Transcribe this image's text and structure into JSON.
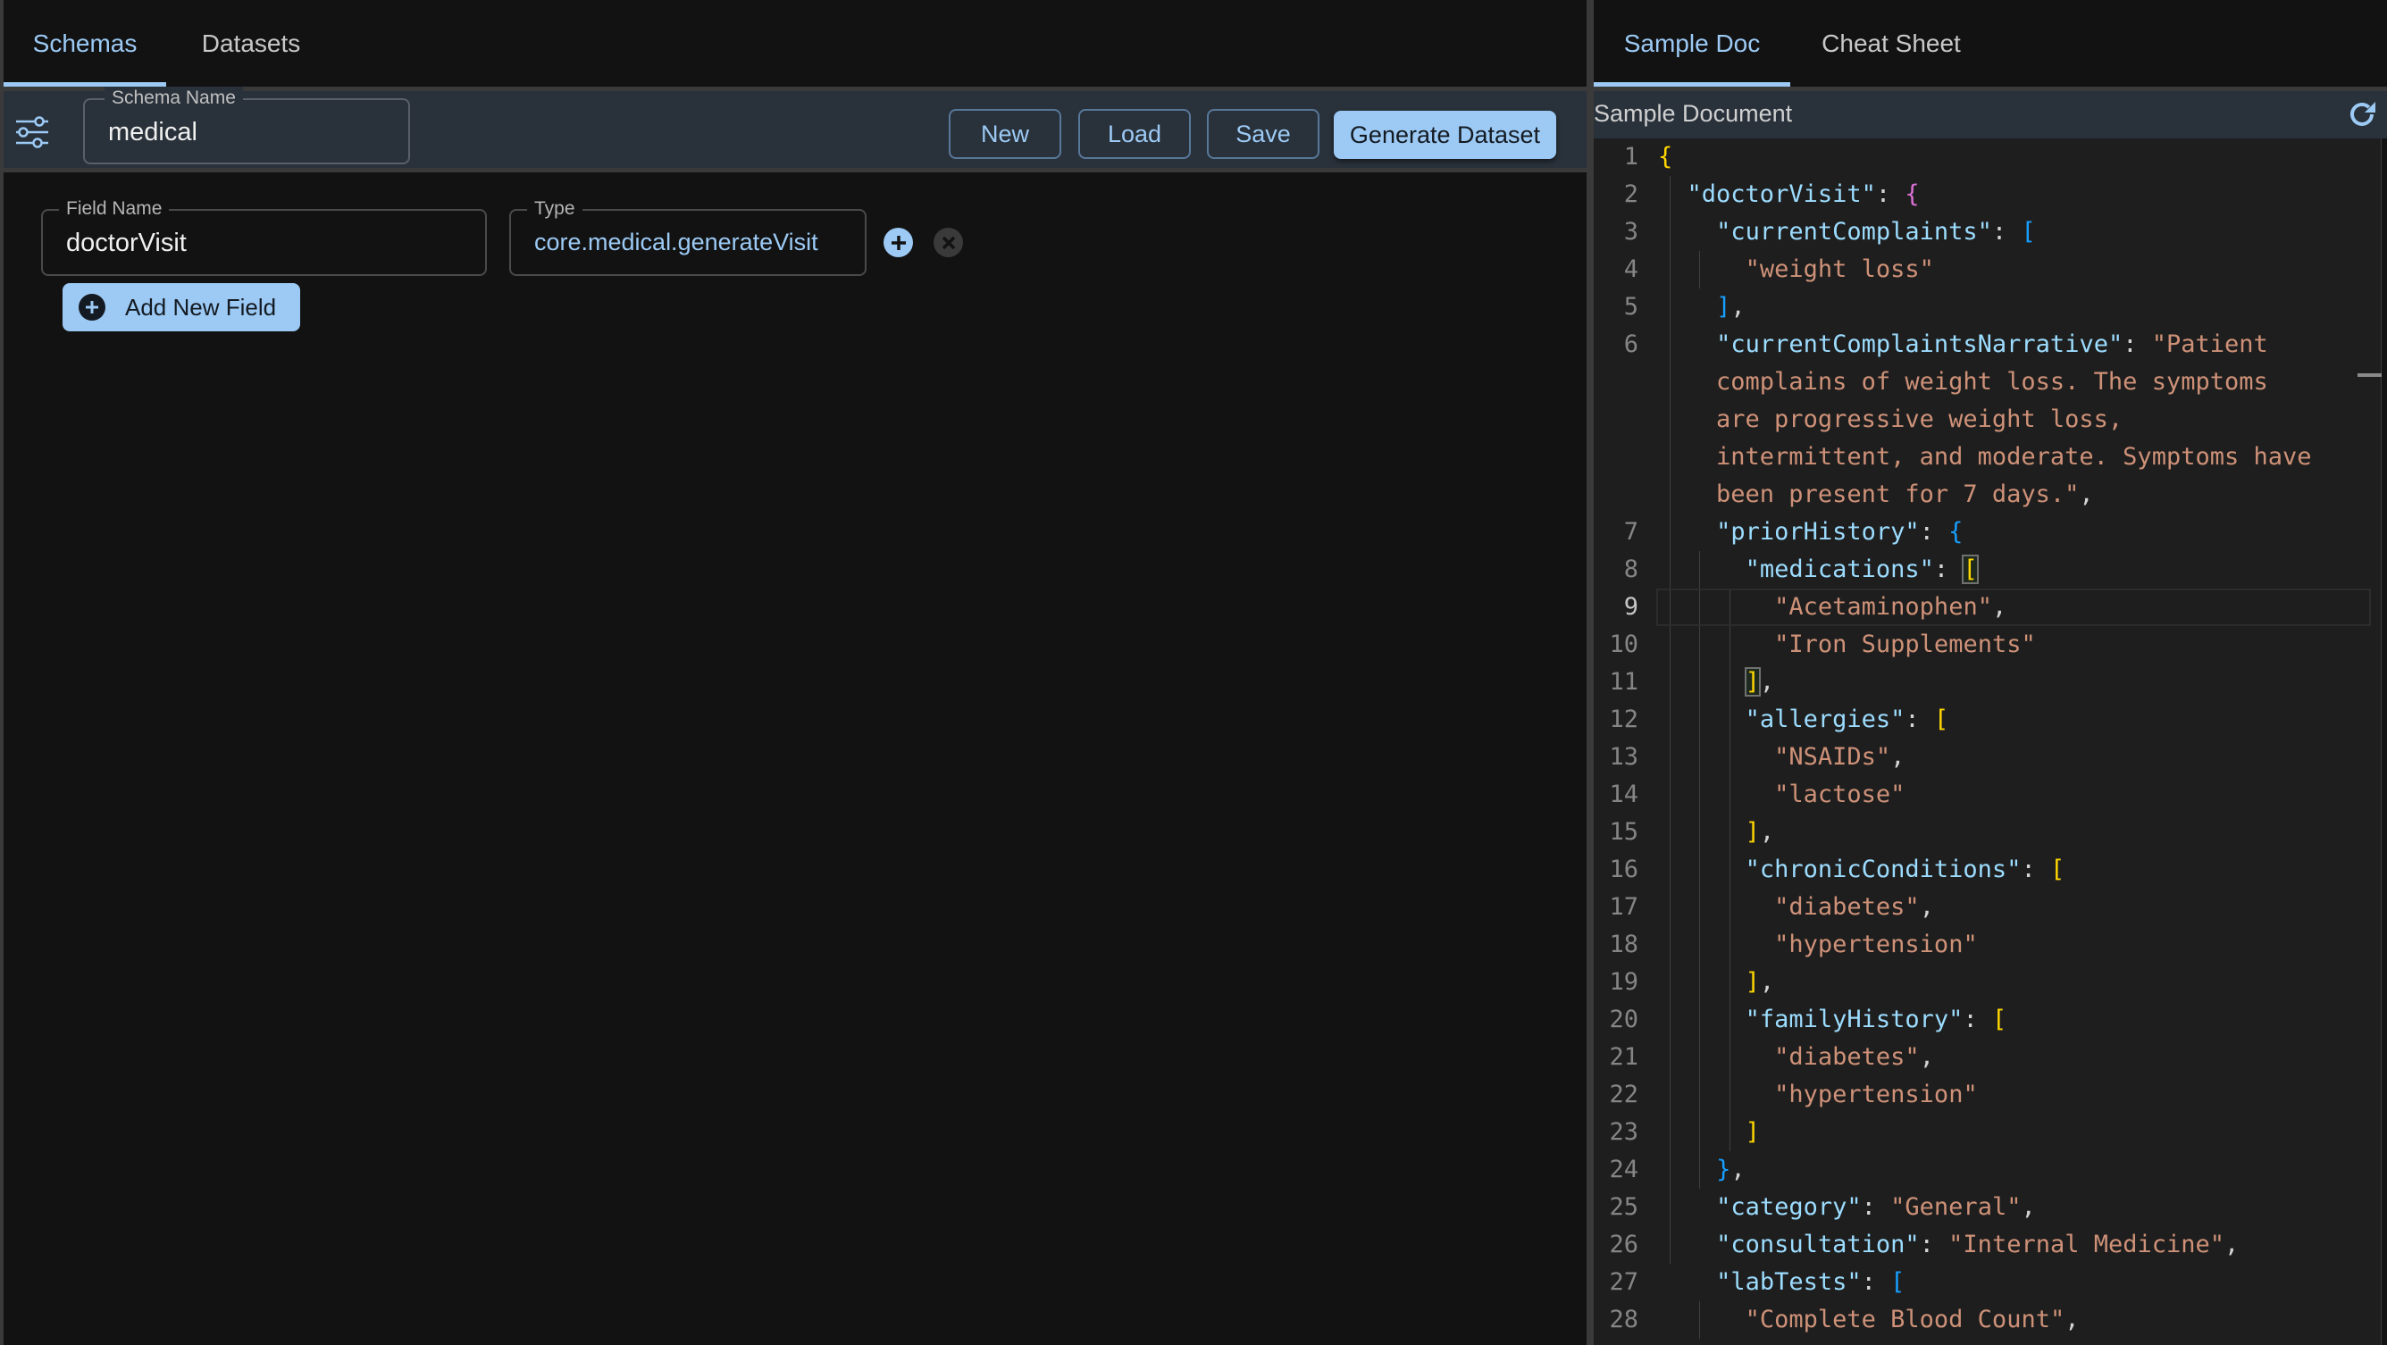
{
  "left": {
    "tabs": [
      {
        "label": "Schemas",
        "active": true
      },
      {
        "label": "Datasets",
        "active": false
      }
    ],
    "header": {
      "filter_icon": "sliders-icon",
      "schema_name_label": "Schema Name",
      "schema_name_value": "medical",
      "buttons": {
        "new": "New",
        "load": "Load",
        "save": "Save",
        "generate": "Generate Dataset"
      }
    },
    "fields": [
      {
        "name_label": "Field Name",
        "name_value": "doctorVisit",
        "type_label": "Type",
        "type_value": "core.medical.generateVisit",
        "add_icon": "plus-circle-icon",
        "remove_icon": "x-circle-icon"
      }
    ],
    "add_field_label": "Add New Field"
  },
  "right": {
    "tabs": [
      {
        "label": "Sample Doc",
        "active": true
      },
      {
        "label": "Cheat Sheet",
        "active": false
      }
    ],
    "header": {
      "title": "Sample Document",
      "refresh_icon": "refresh-icon"
    },
    "editor": {
      "current_line": 9,
      "lines": [
        {
          "n": "1",
          "text": "{"
        },
        {
          "n": "2",
          "text": "  \"doctorVisit\": {"
        },
        {
          "n": "3",
          "text": "    \"currentComplaints\": ["
        },
        {
          "n": "4",
          "text": "      \"weight loss\""
        },
        {
          "n": "5",
          "text": "    ],"
        },
        {
          "n": "6",
          "text": "    \"currentComplaintsNarrative\": \"Patient"
        },
        {
          "n": "",
          "text": "    complains of weight loss. The symptoms"
        },
        {
          "n": "",
          "text": "    are progressive weight loss,"
        },
        {
          "n": "",
          "text": "    intermittent, and moderate. Symptoms have"
        },
        {
          "n": "",
          "text": "    been present for 7 days.\","
        },
        {
          "n": "7",
          "text": "    \"priorHistory\": {"
        },
        {
          "n": "8",
          "text": "      \"medications\": ["
        },
        {
          "n": "9",
          "text": "        \"Acetaminophen\","
        },
        {
          "n": "10",
          "text": "        \"Iron Supplements\""
        },
        {
          "n": "11",
          "text": "      ],"
        },
        {
          "n": "12",
          "text": "      \"allergies\": ["
        },
        {
          "n": "13",
          "text": "        \"NSAIDs\","
        },
        {
          "n": "14",
          "text": "        \"lactose\""
        },
        {
          "n": "15",
          "text": "      ],"
        },
        {
          "n": "16",
          "text": "      \"chronicConditions\": ["
        },
        {
          "n": "17",
          "text": "        \"diabetes\","
        },
        {
          "n": "18",
          "text": "        \"hypertension\""
        },
        {
          "n": "19",
          "text": "      ],"
        },
        {
          "n": "20",
          "text": "      \"familyHistory\": ["
        },
        {
          "n": "21",
          "text": "        \"diabetes\","
        },
        {
          "n": "22",
          "text": "        \"hypertension\""
        },
        {
          "n": "23",
          "text": "      ]"
        },
        {
          "n": "24",
          "text": "    },"
        },
        {
          "n": "25",
          "text": "    \"category\": \"General\","
        },
        {
          "n": "26",
          "text": "    \"consultation\": \"Internal Medicine\","
        },
        {
          "n": "27",
          "text": "    \"labTests\": ["
        },
        {
          "n": "28",
          "text": "      \"Complete Blood Count\","
        }
      ]
    }
  },
  "colors": {
    "accent": "#9ccaf5",
    "panel_header": "#29313a",
    "background": "#121212",
    "editor_bg": "#1e1e1e",
    "json_key": "#9cdcfe",
    "json_string": "#ce9178"
  }
}
